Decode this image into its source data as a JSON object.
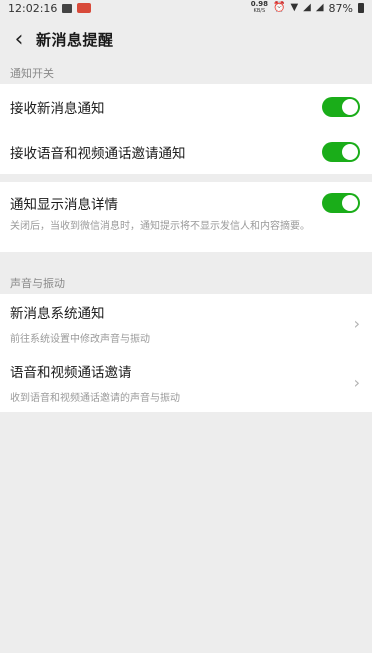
{
  "statusbar": {
    "time": "12:02:16",
    "speed_value": "0.98",
    "speed_unit": "KB/S",
    "battery": "87%"
  },
  "header": {
    "title": "新消息提醒",
    "back_icon": "chevron-left-icon"
  },
  "sections": {
    "notify_switch": {
      "title": "通知开关",
      "items": [
        {
          "label": "接收新消息通知",
          "enabled": true
        },
        {
          "label": "接收语音和视频通话邀请通知",
          "enabled": true
        }
      ]
    },
    "detail": {
      "label": "通知显示消息详情",
      "enabled": true,
      "desc": "关闭后，当收到微信消息时，通知提示将不显示发信人和内容摘要。"
    },
    "sound": {
      "title": "声音与振动",
      "items": [
        {
          "label": "新消息系统通知",
          "desc": "前往系统设置中修改声音与振动"
        },
        {
          "label": "语音和视频通话邀请",
          "desc": "收到语音和视频通话邀请的声音与振动"
        }
      ]
    }
  },
  "colors": {
    "toggle_on": "#1aad19",
    "background": "#ededed"
  }
}
